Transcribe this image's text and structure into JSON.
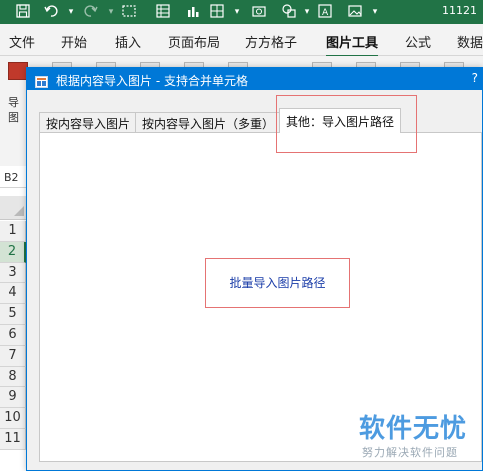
{
  "qat": {
    "icons": [
      "save-icon",
      "undo-icon",
      "redo-icon",
      "select-icon",
      "table-icon",
      "chart-icon",
      "shape-icon",
      "camera-icon",
      "text-icon",
      "image-icon"
    ],
    "title_number": "11121"
  },
  "ribbon_tabs": [
    "文件",
    "开始",
    "插入",
    "页面布局",
    "方方格子",
    "图片工具",
    "公式",
    "数据"
  ],
  "active_ribbon_tab": "图片工具",
  "ribbon": {
    "left_text_line1": "导",
    "left_text_line2": "图"
  },
  "sheet": {
    "name_box": "B2",
    "row_numbers": [
      "1",
      "2",
      "3",
      "4",
      "5",
      "6",
      "7",
      "8",
      "9",
      "10",
      "11"
    ],
    "selected_row": "2"
  },
  "dialog": {
    "title": "根据内容导入图片 - 支持合并单元格",
    "help": "?",
    "tabs": [
      "按内容导入图片",
      "按内容导入图片（多重）",
      "其他：导入图片路径"
    ],
    "active_tab_index": 2,
    "button_label": "批量导入图片路径"
  },
  "watermark": {
    "title": "软件无忧",
    "subtitle": "努力解决软件问题"
  },
  "colors": {
    "excel_green": "#217346",
    "dialog_blue": "#0078d7",
    "highlight_red": "#e57373",
    "button_text": "#1a3ca8",
    "watermark_blue": "#4d9be0"
  }
}
